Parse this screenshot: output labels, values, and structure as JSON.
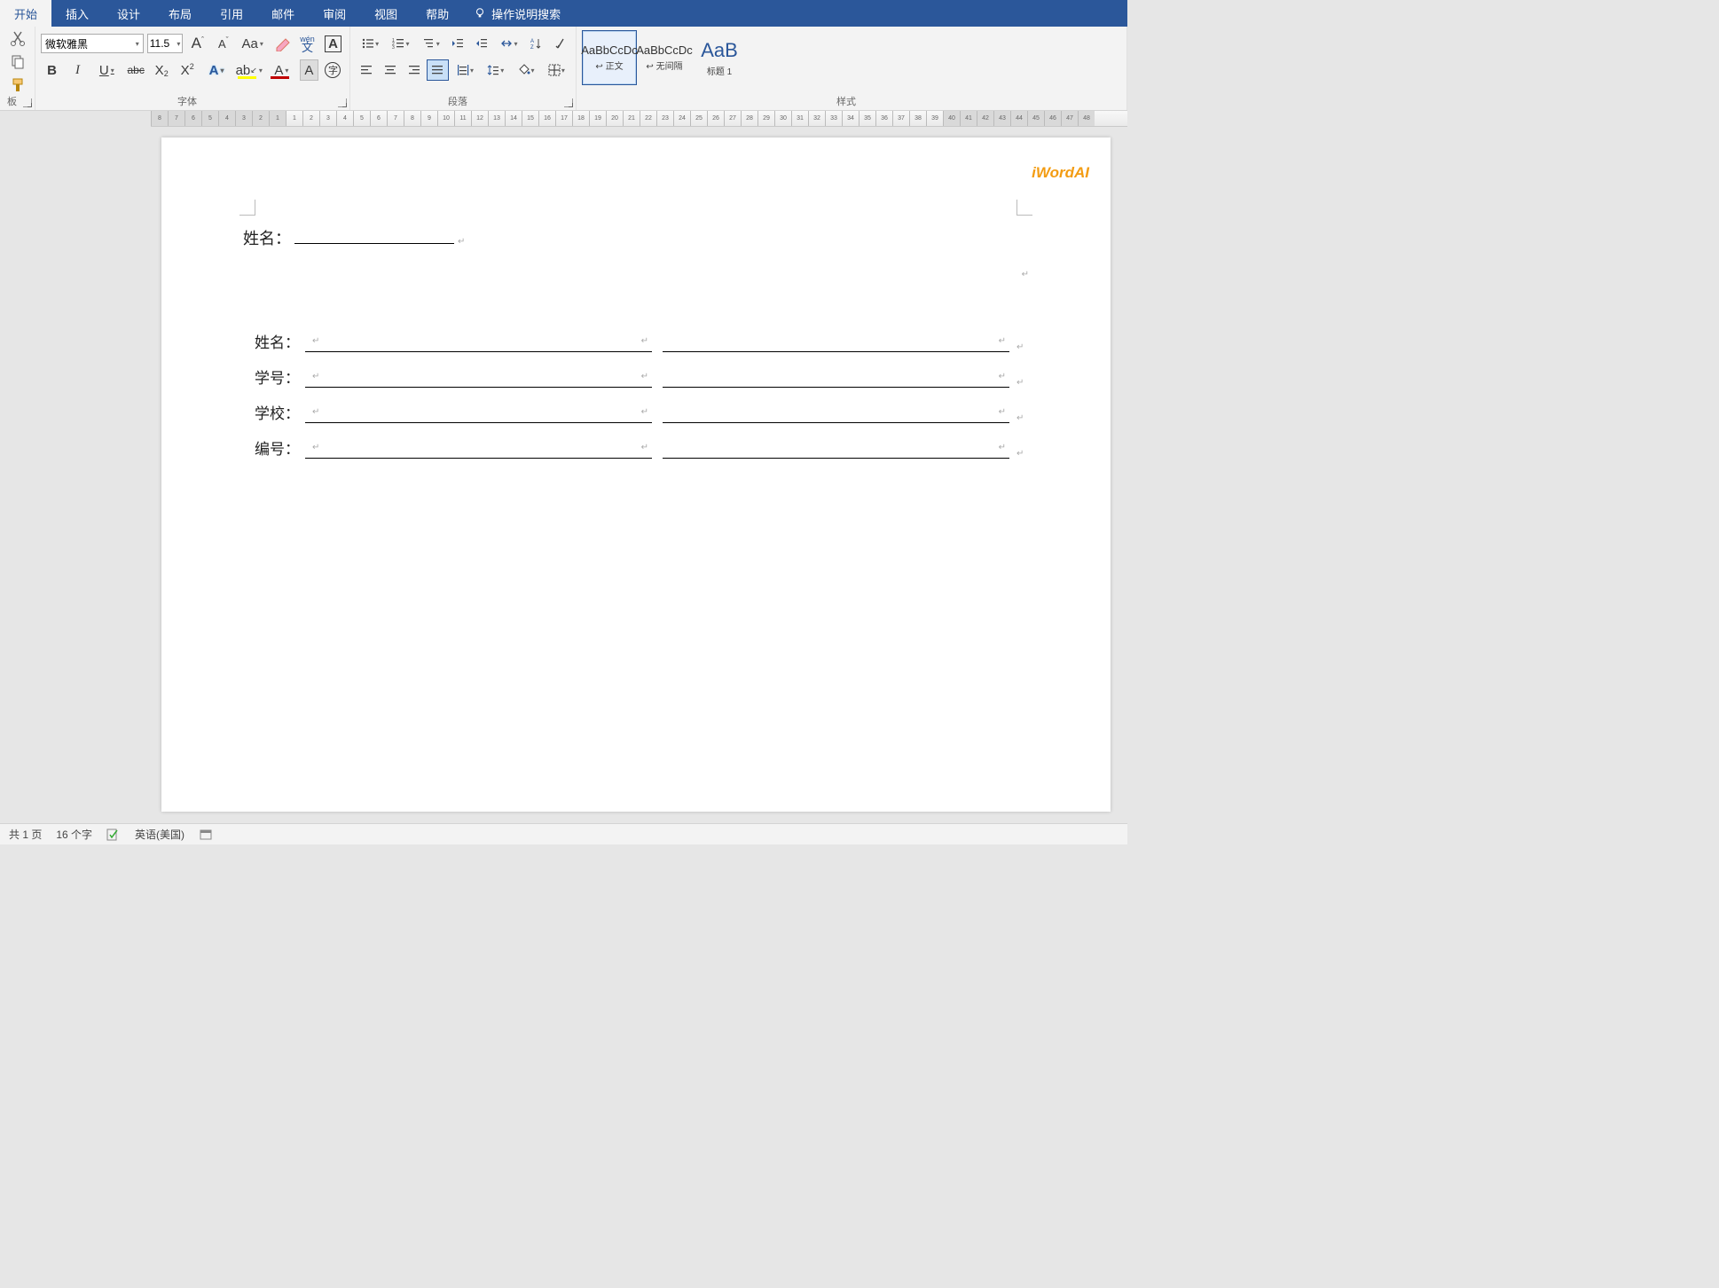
{
  "tabs": {
    "home": "开始",
    "insert": "插入",
    "design": "设计",
    "layout": "布局",
    "references": "引用",
    "mailings": "邮件",
    "review": "审阅",
    "view": "视图",
    "help": "帮助",
    "tell_me": "操作说明搜索"
  },
  "clipboard": {
    "label": "板"
  },
  "font": {
    "name": "微软雅黑",
    "size": "11.5",
    "group_label": "字体",
    "grow": "A",
    "shrink": "A",
    "case": "Aa",
    "phonetic_top": "wén",
    "phonetic_bottom": "文",
    "charborder": "A",
    "bold": "B",
    "italic": "I",
    "underline": "U",
    "strike": "abc",
    "sub": "X",
    "sup": "X",
    "effects": "A",
    "highlight": "ab",
    "color": "A",
    "shading": "A",
    "enclose": "字"
  },
  "paragraph": {
    "group_label": "段落"
  },
  "styles": {
    "group_label": "样式",
    "items": [
      {
        "preview": "AaBbCcDc",
        "name": "↩ 正文"
      },
      {
        "preview": "AaBbCcDc",
        "name": "↩ 无间隔"
      },
      {
        "preview": "AaB",
        "name": "标题 1"
      }
    ]
  },
  "document": {
    "watermark": "iWordAI",
    "line1_label": "姓名：",
    "table": [
      {
        "label": "姓名："
      },
      {
        "label": "学号："
      },
      {
        "label": "学校："
      },
      {
        "label": "编号："
      }
    ]
  },
  "statusbar": {
    "pages": "共 1 页",
    "words": "16 个字",
    "language": "英语(美国)"
  }
}
